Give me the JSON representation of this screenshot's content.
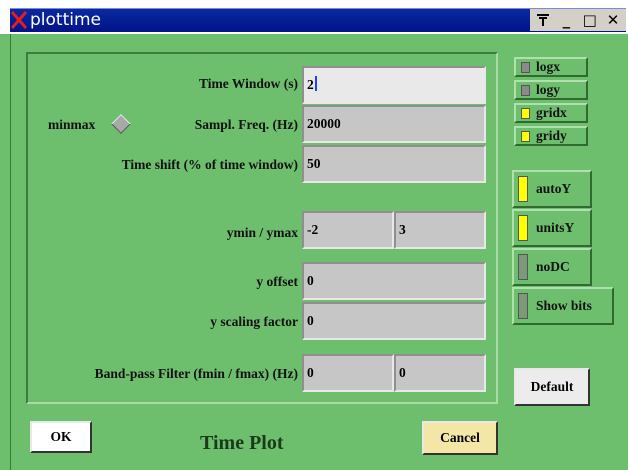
{
  "window": {
    "title": "plottime"
  },
  "colors": {
    "accent_on": "#ffff00",
    "background": "#6dbe6d",
    "titlebar": "#00138a"
  },
  "titlebar_buttons": {
    "pin": "₸",
    "minimize": "_",
    "maximize": "□",
    "close": "✕"
  },
  "form": {
    "time_window": {
      "label": "Time Window (s)",
      "value": "2"
    },
    "minmax": {
      "label": "minmax"
    },
    "sampl_freq": {
      "label": "Sampl. Freq. (Hz)",
      "value": "20000"
    },
    "time_shift": {
      "label": "Time shift (% of time window)",
      "value": "50"
    },
    "ymin_ymax": {
      "label": "ymin / ymax",
      "min": "-2",
      "max": "3"
    },
    "y_offset": {
      "label": "y offset",
      "value": "0"
    },
    "y_scaling": {
      "label": "y scaling factor",
      "value": "0"
    },
    "bandpass": {
      "label": "Band-pass Filter (fmin / fmax)  (Hz)",
      "fmin": "0",
      "fmax": "0"
    }
  },
  "checks": [
    {
      "label": "logx",
      "on": false
    },
    {
      "label": "logy",
      "on": false
    },
    {
      "label": "gridx",
      "on": true
    },
    {
      "label": "gridy",
      "on": true
    }
  ],
  "toggles": [
    {
      "label": "autoY",
      "on": true
    },
    {
      "label": "unitsY",
      "on": true
    },
    {
      "label": "noDC",
      "on": false
    },
    {
      "label": "Show bits",
      "on": false
    }
  ],
  "buttons": {
    "default": "Default",
    "ok": "OK",
    "cancel": "Cancel"
  },
  "footer": {
    "title": "Time Plot"
  }
}
